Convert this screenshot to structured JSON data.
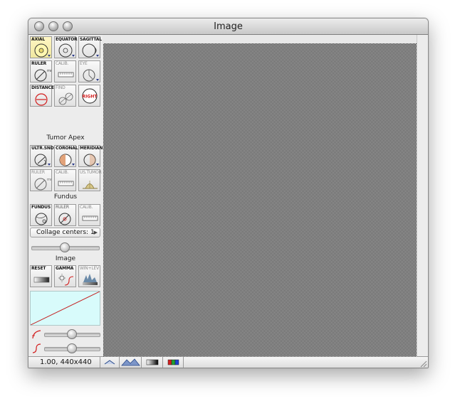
{
  "window": {
    "title": "Image"
  },
  "tools": {
    "axial": "AXIAL",
    "equator": "EQUATOR",
    "sagittal": "SAGITTAL",
    "ruler": "RULER",
    "calib": "CALIB.",
    "eye": "EYE",
    "distance": "DISTANCE",
    "find": "FIND",
    "right_badge": "RIGHT"
  },
  "sections": {
    "tumor_apex": "Tumor Apex",
    "fundus": "Fundus",
    "image": "Image"
  },
  "tumor_tools": {
    "ultra_snd": "ULTR.SND",
    "coronal": "CORONAL",
    "meridian": "MERIDIAN",
    "ruler": "RULER",
    "calib": "CALIB.",
    "us_tumor": "US.TUMOR"
  },
  "fundus_tools": {
    "fundus": "FUNDUS",
    "ruler": "RULER",
    "calib": "CALIB."
  },
  "collage": {
    "label": "Collage centers: 1"
  },
  "image_tools": {
    "reset": "RESET",
    "gamma": "GAMMA",
    "win_lev": "WIN+LEV"
  },
  "sliders": {
    "collage_slider": 0.5,
    "brightness": 0.5,
    "contrast": 0.5,
    "gamma": 0.5
  },
  "status": {
    "text": "1.00, 440x440"
  },
  "colors": {
    "curve_bg": "#d8fbfb",
    "curve_line": "#c41e1e",
    "accent_red": "#d21d1d"
  }
}
